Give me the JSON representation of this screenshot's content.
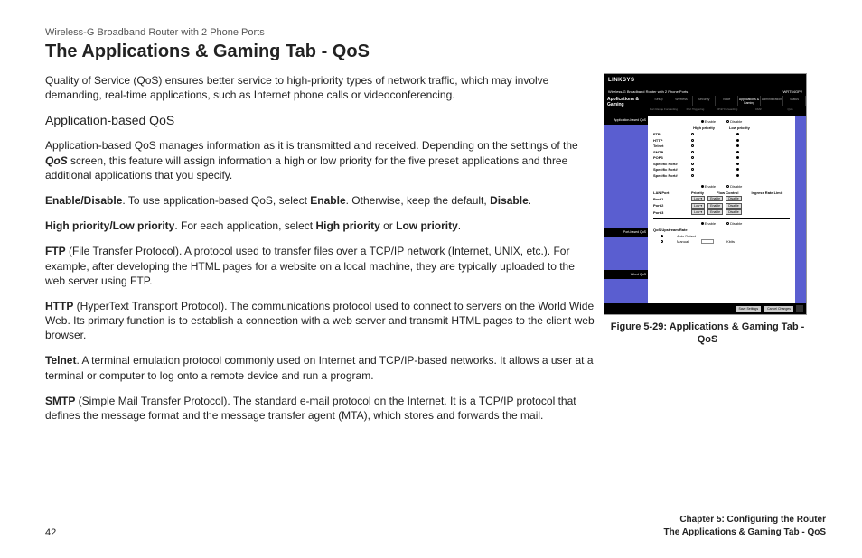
{
  "header": {
    "product": "Wireless-G Broadband Router with 2 Phone Ports"
  },
  "title": "The Applications & Gaming Tab - QoS",
  "intro": "Quality of Service (QoS) ensures better service to high-priority types of network traffic, which may involve demanding, real-time applications, such as Internet phone calls or videoconferencing.",
  "section_heading": "Application-based QoS",
  "app_qos_intro_pre": "Application-based QoS manages information as it is transmitted and received. Depending on the settings of the ",
  "app_qos_intro_em": "QoS",
  "app_qos_intro_post": " screen, this feature will assign information a high or low priority for the five preset applications and three additional applications that you specify.",
  "enable": {
    "label": "Enable/Disable",
    "pre": ". To use application-based QoS, select ",
    "b1": "Enable",
    "mid": ". Otherwise, keep the default, ",
    "b2": "Disable",
    "post": "."
  },
  "priority": {
    "label": "High priority/Low priority",
    "pre": ". For each application, select ",
    "b1": "High priority",
    "mid": " or ",
    "b2": "Low priority",
    "post": "."
  },
  "ftp": {
    "label": "FTP",
    "text": " (File Transfer Protocol). A protocol used to transfer files over a TCP/IP network (Internet, UNIX, etc.). For example, after developing the HTML pages for a website on a local machine, they are typically uploaded to the web server using FTP."
  },
  "http": {
    "label": "HTTP",
    "text": " (HyperText Transport Protocol). The communications protocol used to connect to servers on the World Wide Web. Its primary function is to establish a connection with a web server and transmit HTML pages to the client web browser."
  },
  "telnet": {
    "label": "Telnet",
    "text": ". A terminal emulation protocol commonly used on Internet and TCP/IP-based networks. It allows a user at a terminal or computer to log onto a remote device and run a program."
  },
  "smtp": {
    "label": "SMTP",
    "text": " (Simple Mail Transfer Protocol). The standard e-mail protocol on the Internet. It is a TCP/IP protocol that defines the message format and the message transfer agent (MTA), which stores and forwards the mail."
  },
  "figure_caption": "Figure 5-29: Applications & Gaming Tab - QoS",
  "footer": {
    "page": "42",
    "chapter": "Chapter 5: Configuring the Router",
    "section": "The Applications & Gaming Tab - QoS"
  },
  "mini": {
    "brand": "LINKSYS",
    "model": "Wireless-G Broadband Router with 2 Phone Ports",
    "modelnum": "WRT54GP2",
    "tab_group": "Applications & Gaming",
    "tabs_top": [
      "Setup",
      "Wireless",
      "Security",
      "Voice",
      "Applications & Gaming",
      "Administration",
      "Status"
    ],
    "tabs_bottom": [
      "Port Range Forwarding",
      "Port Triggering",
      "UPnP Forwarding",
      "DMZ",
      "QoS"
    ],
    "side1": "Application-based QoS",
    "side2": "Port-based QoS",
    "side3": "Wired QoS",
    "enable": "Enable",
    "disable": "Disable",
    "col1": "High priority",
    "col2": "Low priority",
    "apps": [
      "FTP",
      "HTTP",
      "Telnet",
      "SMTP",
      "POP3",
      "Specific Port#",
      "Specific Port#",
      "Specific Port#"
    ],
    "port_header": [
      "LAN Port",
      "Priority",
      "Flow Control",
      "Ingress Rate Limit"
    ],
    "ports": [
      "Port 1",
      "Port 2",
      "Port 3"
    ],
    "btn_enable": "Enable",
    "btn_disable": "Disable",
    "upstream": "QoS Upstream Rate",
    "auto": "Auto Detect",
    "manual": "Manual",
    "kbps": "Kbits",
    "save": "Save Settings",
    "cancel": "Cancel Changes"
  }
}
